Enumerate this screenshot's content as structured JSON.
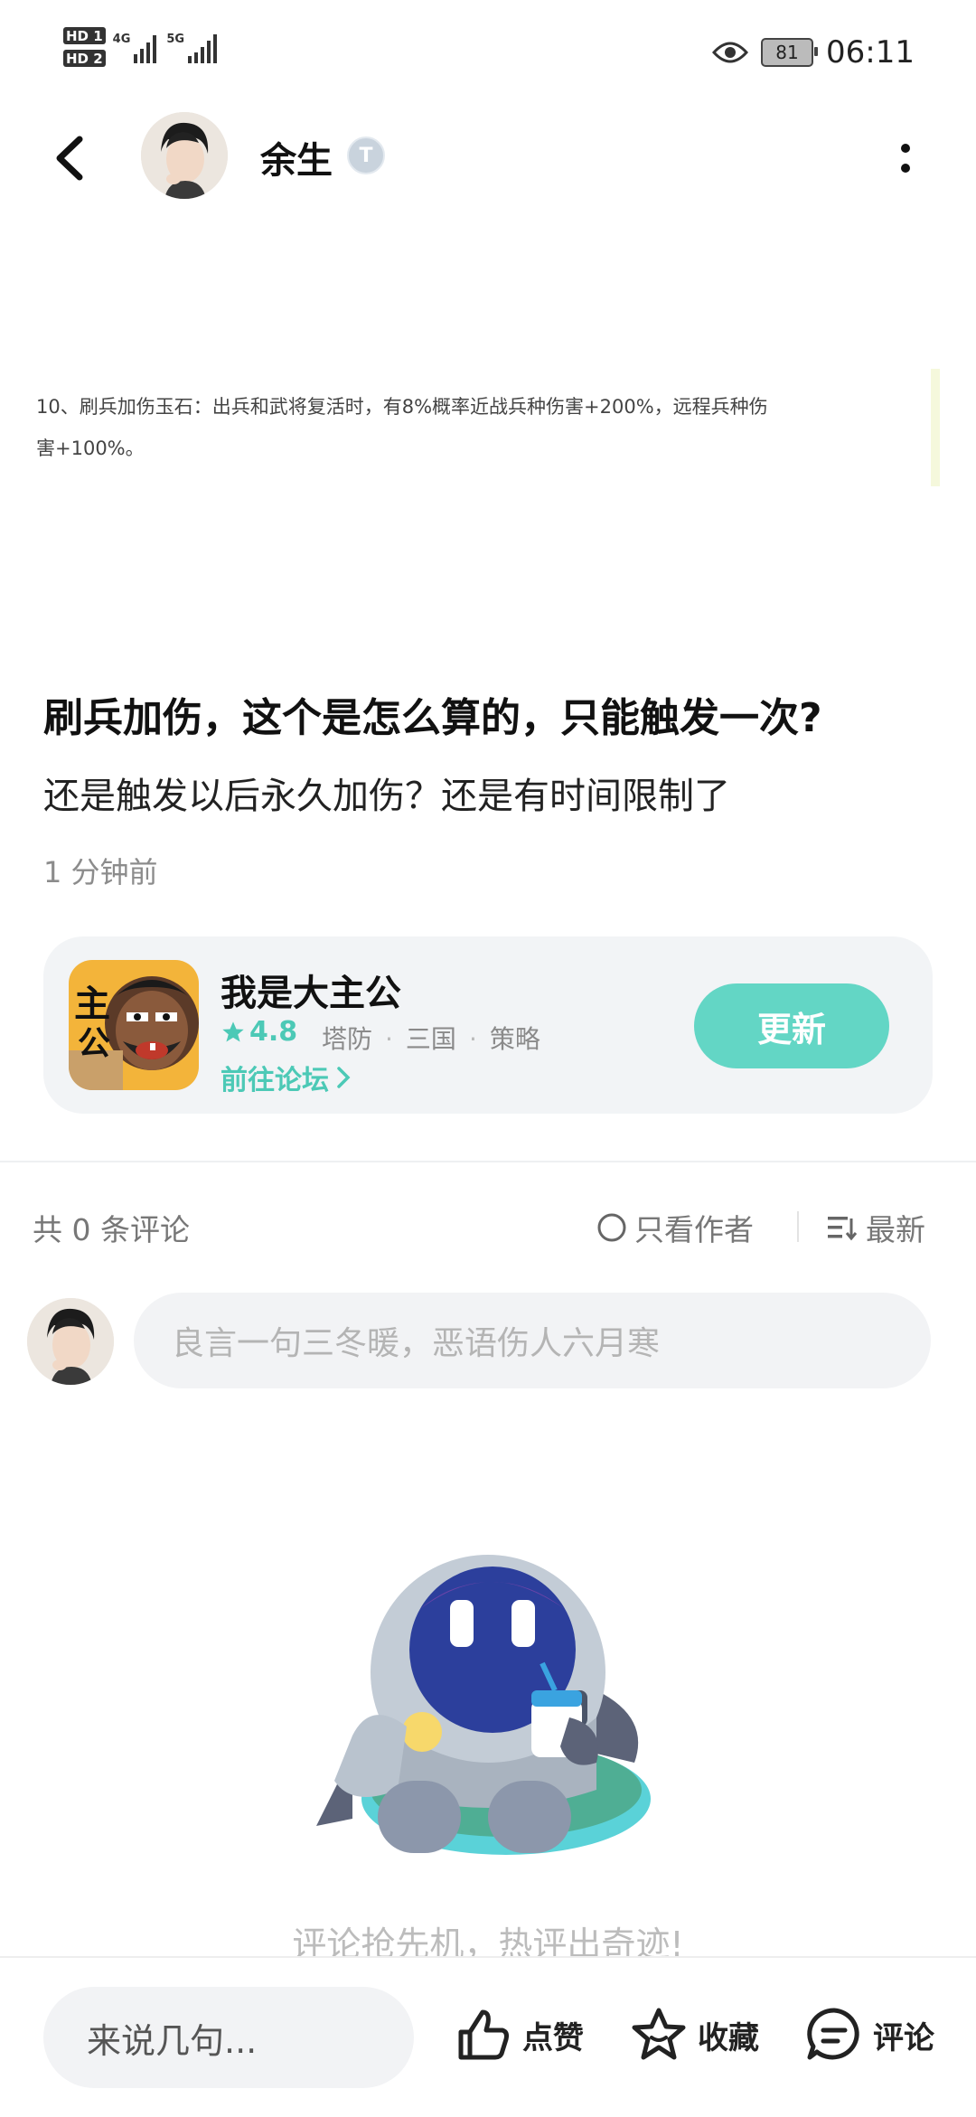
{
  "status_bar": {
    "hd1": "HD 1",
    "hd2": "HD 2",
    "net1": "4G",
    "net2": "5G",
    "battery": "81",
    "time": "06:11"
  },
  "header": {
    "user_name": "余生",
    "badge": "T"
  },
  "post": {
    "image_lines": [
      "10、刷兵加伤玉石：出兵和武将复活时，有8%概率近战兵种伤害+200%，远程兵种伤",
      "害+100%。"
    ],
    "title": "刷兵加伤，这个是怎么算的，只能触发一次?",
    "body": "还是触发以后永久加伤？还是有时间限制了",
    "time": "1 分钟前"
  },
  "game_card": {
    "icon_text": "主公",
    "name": "我是大主公",
    "rating": "4.8",
    "tags": [
      "塔防",
      "三国",
      "策略"
    ],
    "forum_link": "前往论坛",
    "update_button": "更新"
  },
  "comments": {
    "count_label": "共 0 条评论",
    "author_only": "只看作者",
    "sort": "最新",
    "input_placeholder": "良言一句三冬暖，恶语伤人六月寒",
    "empty_text": "评论抢先机，热评出奇迹!"
  },
  "bottom_bar": {
    "say_placeholder": "来说几句...",
    "like": "点赞",
    "favorite": "收藏",
    "comment": "评论"
  },
  "colors": {
    "accent": "#4cc9b6",
    "button": "#63d6c5",
    "card_bg": "#f2f4f6"
  }
}
